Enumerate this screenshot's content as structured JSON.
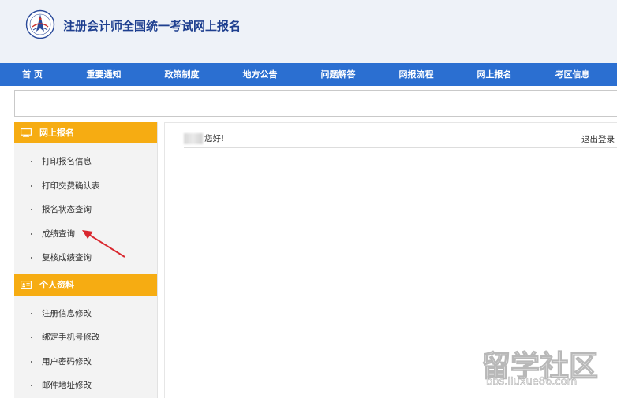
{
  "header": {
    "title": "注册会计师全国统一考试网上报名",
    "logo_icon": "cicpa-seal-icon"
  },
  "nav": {
    "items": [
      {
        "label": "首 页"
      },
      {
        "label": "重要通知"
      },
      {
        "label": "政策制度"
      },
      {
        "label": "地方公告"
      },
      {
        "label": "问题解答"
      },
      {
        "label": "网报流程"
      },
      {
        "label": "网上报名"
      },
      {
        "label": "考区信息"
      }
    ]
  },
  "sidebar": {
    "section1": {
      "title": "网上报名",
      "icon": "monitor-icon",
      "items": [
        {
          "label": "打印报名信息"
        },
        {
          "label": "打印交费确认表"
        },
        {
          "label": "报名状态查询"
        },
        {
          "label": "成绩查询"
        },
        {
          "label": "复核成绩查询"
        }
      ]
    },
    "section2": {
      "title": "个人资料",
      "icon": "id-card-icon",
      "items": [
        {
          "label": "注册信息修改"
        },
        {
          "label": "绑定手机号修改"
        },
        {
          "label": "用户密码修改"
        },
        {
          "label": "邮件地址修改"
        }
      ]
    }
  },
  "main": {
    "greeting": "您好!",
    "logout": "退出登录"
  },
  "watermark": {
    "main": "留学社区",
    "sub": "bbs.liuxue86.com"
  },
  "colors": {
    "nav_bg": "#2b6fd1",
    "sidebar_header": "#f6ac12",
    "header_bg": "#eef2f8",
    "title_text": "#1e3f8f",
    "arrow": "#d9282f"
  }
}
